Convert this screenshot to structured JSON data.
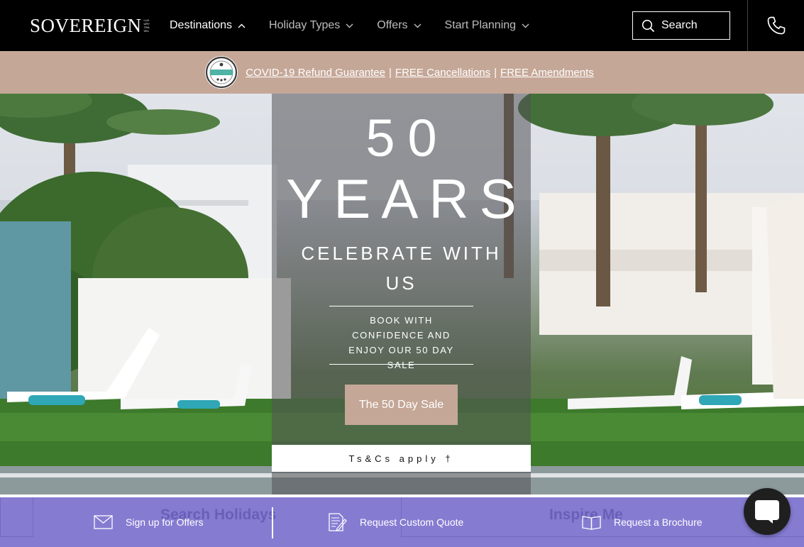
{
  "header": {
    "logo_text": "SOVEREIGN",
    "logo_subtext": "LUXURY TRAVEL",
    "nav": [
      {
        "label": "Destinations",
        "icon": "chevron-up-icon"
      },
      {
        "label": "Holiday Types",
        "icon": "chevron-down-icon"
      },
      {
        "label": "Offers",
        "icon": "chevron-down-icon"
      },
      {
        "label": "Start Planning",
        "icon": "chevron-down-icon"
      }
    ],
    "search_label": "Search",
    "phone_icon": "phone-icon"
  },
  "banner": {
    "badge_icon": "refund-guarantee-badge-icon",
    "link_1": "COVID-19 Refund Guarantee",
    "separator": "|",
    "link_2": "FREE Cancellations",
    "link_3": "FREE Amendments",
    "background": "#c5a797"
  },
  "hero": {
    "title_number": "50",
    "title_word": "YEARS",
    "subtitle": "CELEBRATE WITH US",
    "body": "BOOK WITH CONFIDENCE AND ENJOY OUR 50 DAY SALE",
    "cta_label": "The 50 Day Sale",
    "terms_label": "Ts&Cs apply †",
    "accent": "#c5a797"
  },
  "bottom_bar": {
    "ghost_left": "Search Holidays",
    "ghost_right": "Inspire Me",
    "items": [
      {
        "label": "Sign up for Offers",
        "icon": "envelope-icon"
      },
      {
        "label": "Request Custom Quote",
        "icon": "document-pen-icon"
      },
      {
        "label": "Request a Brochure",
        "icon": "open-book-icon"
      }
    ],
    "chat_icon": "chat-bubble-icon",
    "background": "#786ecd"
  }
}
